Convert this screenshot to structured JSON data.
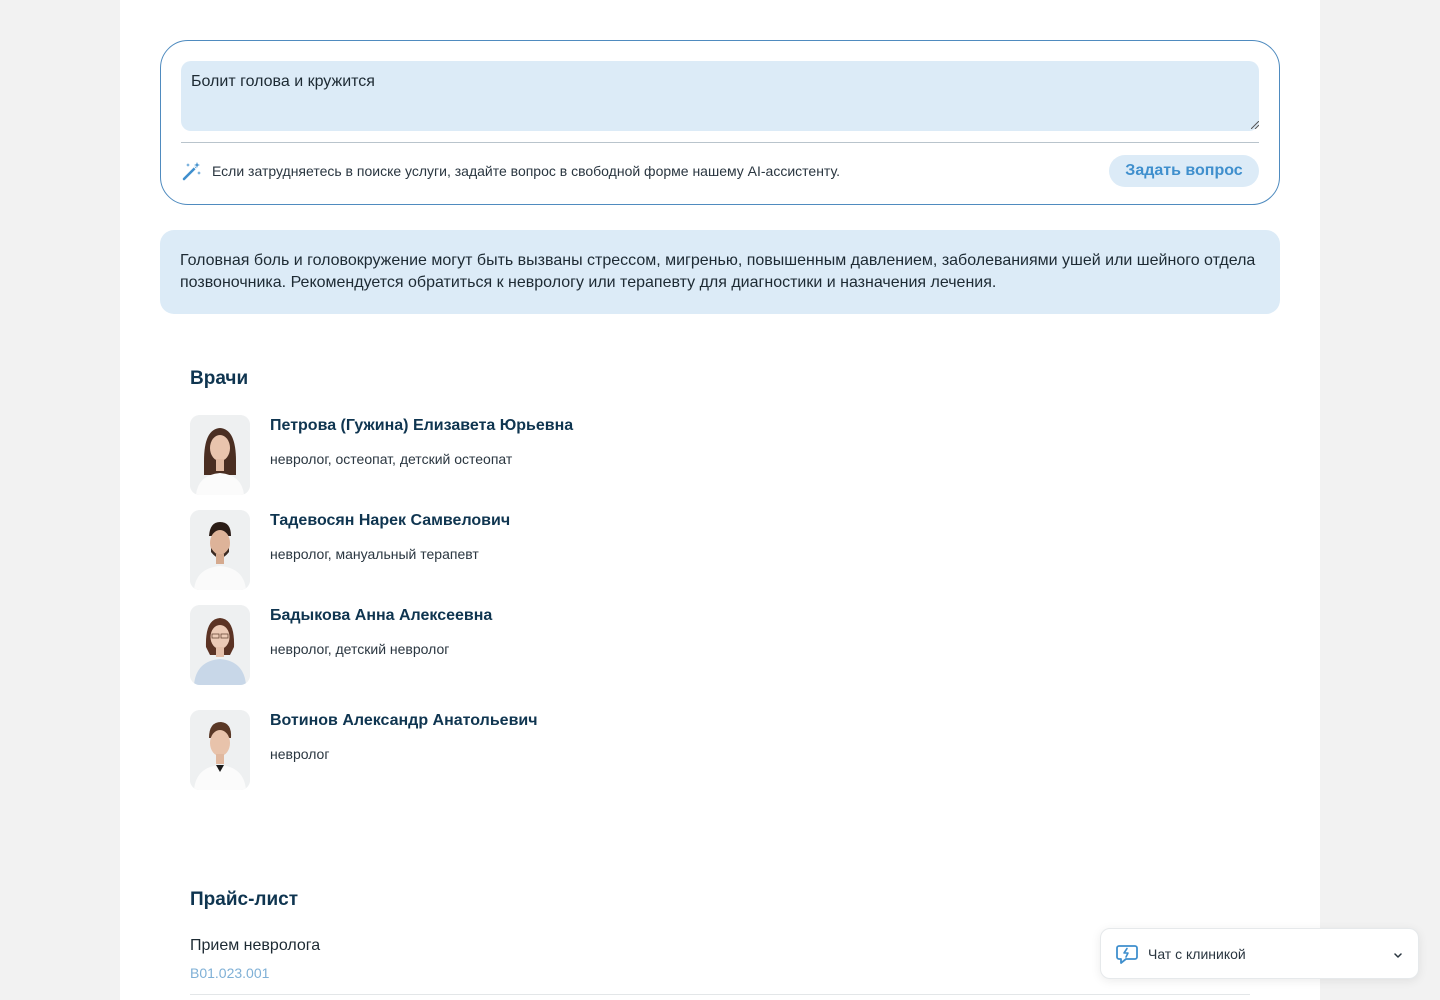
{
  "ask": {
    "input_value": "Болит голова и кружится",
    "hint": "Если затрудняетесь в поиске услуги, задайте вопрос в свободной форме нашему AI-ассистенту.",
    "button_label": "Задать вопрос"
  },
  "answer": {
    "text": "Головная боль и головокружение могут быть вызваны стрессом, мигренью, повышенным давлением, заболеваниями ушей или шейного отдела позвоночника. Рекомендуется обратиться к неврологу или терапевту для диагностики и назначения лечения."
  },
  "doctors": {
    "title": "Врачи",
    "items": [
      {
        "name": "Петрова (Гужина) Елизавета Юрьевна",
        "spec": "невролог, остеопат, детский остеопат"
      },
      {
        "name": "Тадевосян Нарек Самвелович",
        "spec": "невролог, мануальный терапевт"
      },
      {
        "name": "Бадыкова Анна Алексеевна",
        "spec": "невролог, детский невролог"
      },
      {
        "name": "Вотинов Александр Анатольевич",
        "spec": "невролог"
      }
    ]
  },
  "price_list": {
    "title": "Прайс-лист",
    "items": [
      {
        "name": "Прием невролога",
        "code": "B01.023.001"
      }
    ]
  },
  "chat": {
    "label": "Чат с клиникой"
  },
  "colors": {
    "accent": "#3f8fcd",
    "light_blue": "#dcebf7",
    "heading": "#0f3550"
  }
}
